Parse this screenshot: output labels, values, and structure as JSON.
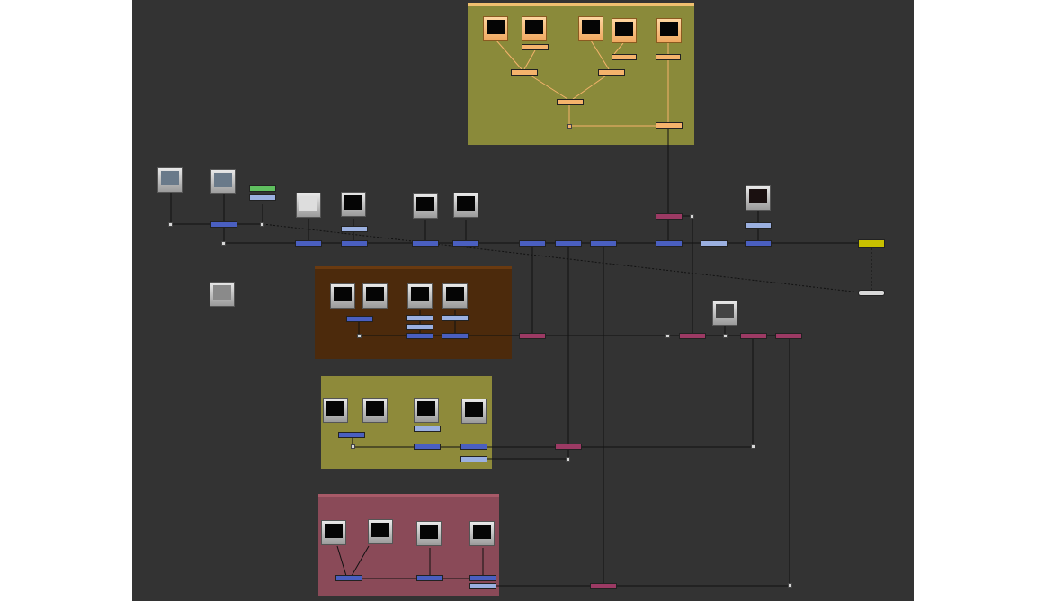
{
  "app": {
    "title": ""
  },
  "colors": {
    "canvas": "#333333",
    "merge_node": "#4a5fc0",
    "grade_node": "#9bb0e0",
    "switch_node": "#9c3a64",
    "write_node": "#c8c000",
    "viewer_node": "#d8d8d8",
    "green_node": "#5fbf5f",
    "orange_node": "#f5b36c",
    "backdrop_yellow": "#8a8a3a",
    "backdrop_brown": "#4c2a0c",
    "backdrop_olive": "#8e8a3a",
    "backdrop_rose": "#8a4a58"
  },
  "backdrops": [
    {
      "name": "yellow-top",
      "label": ""
    },
    {
      "name": "brown",
      "label": ""
    },
    {
      "name": "olive",
      "label": ""
    },
    {
      "name": "rose",
      "label": ""
    }
  ],
  "icons": [
    "read-node-thumbnail",
    "merge-node",
    "grade-node",
    "switch-node",
    "write-node",
    "viewer-node",
    "dot-node"
  ]
}
